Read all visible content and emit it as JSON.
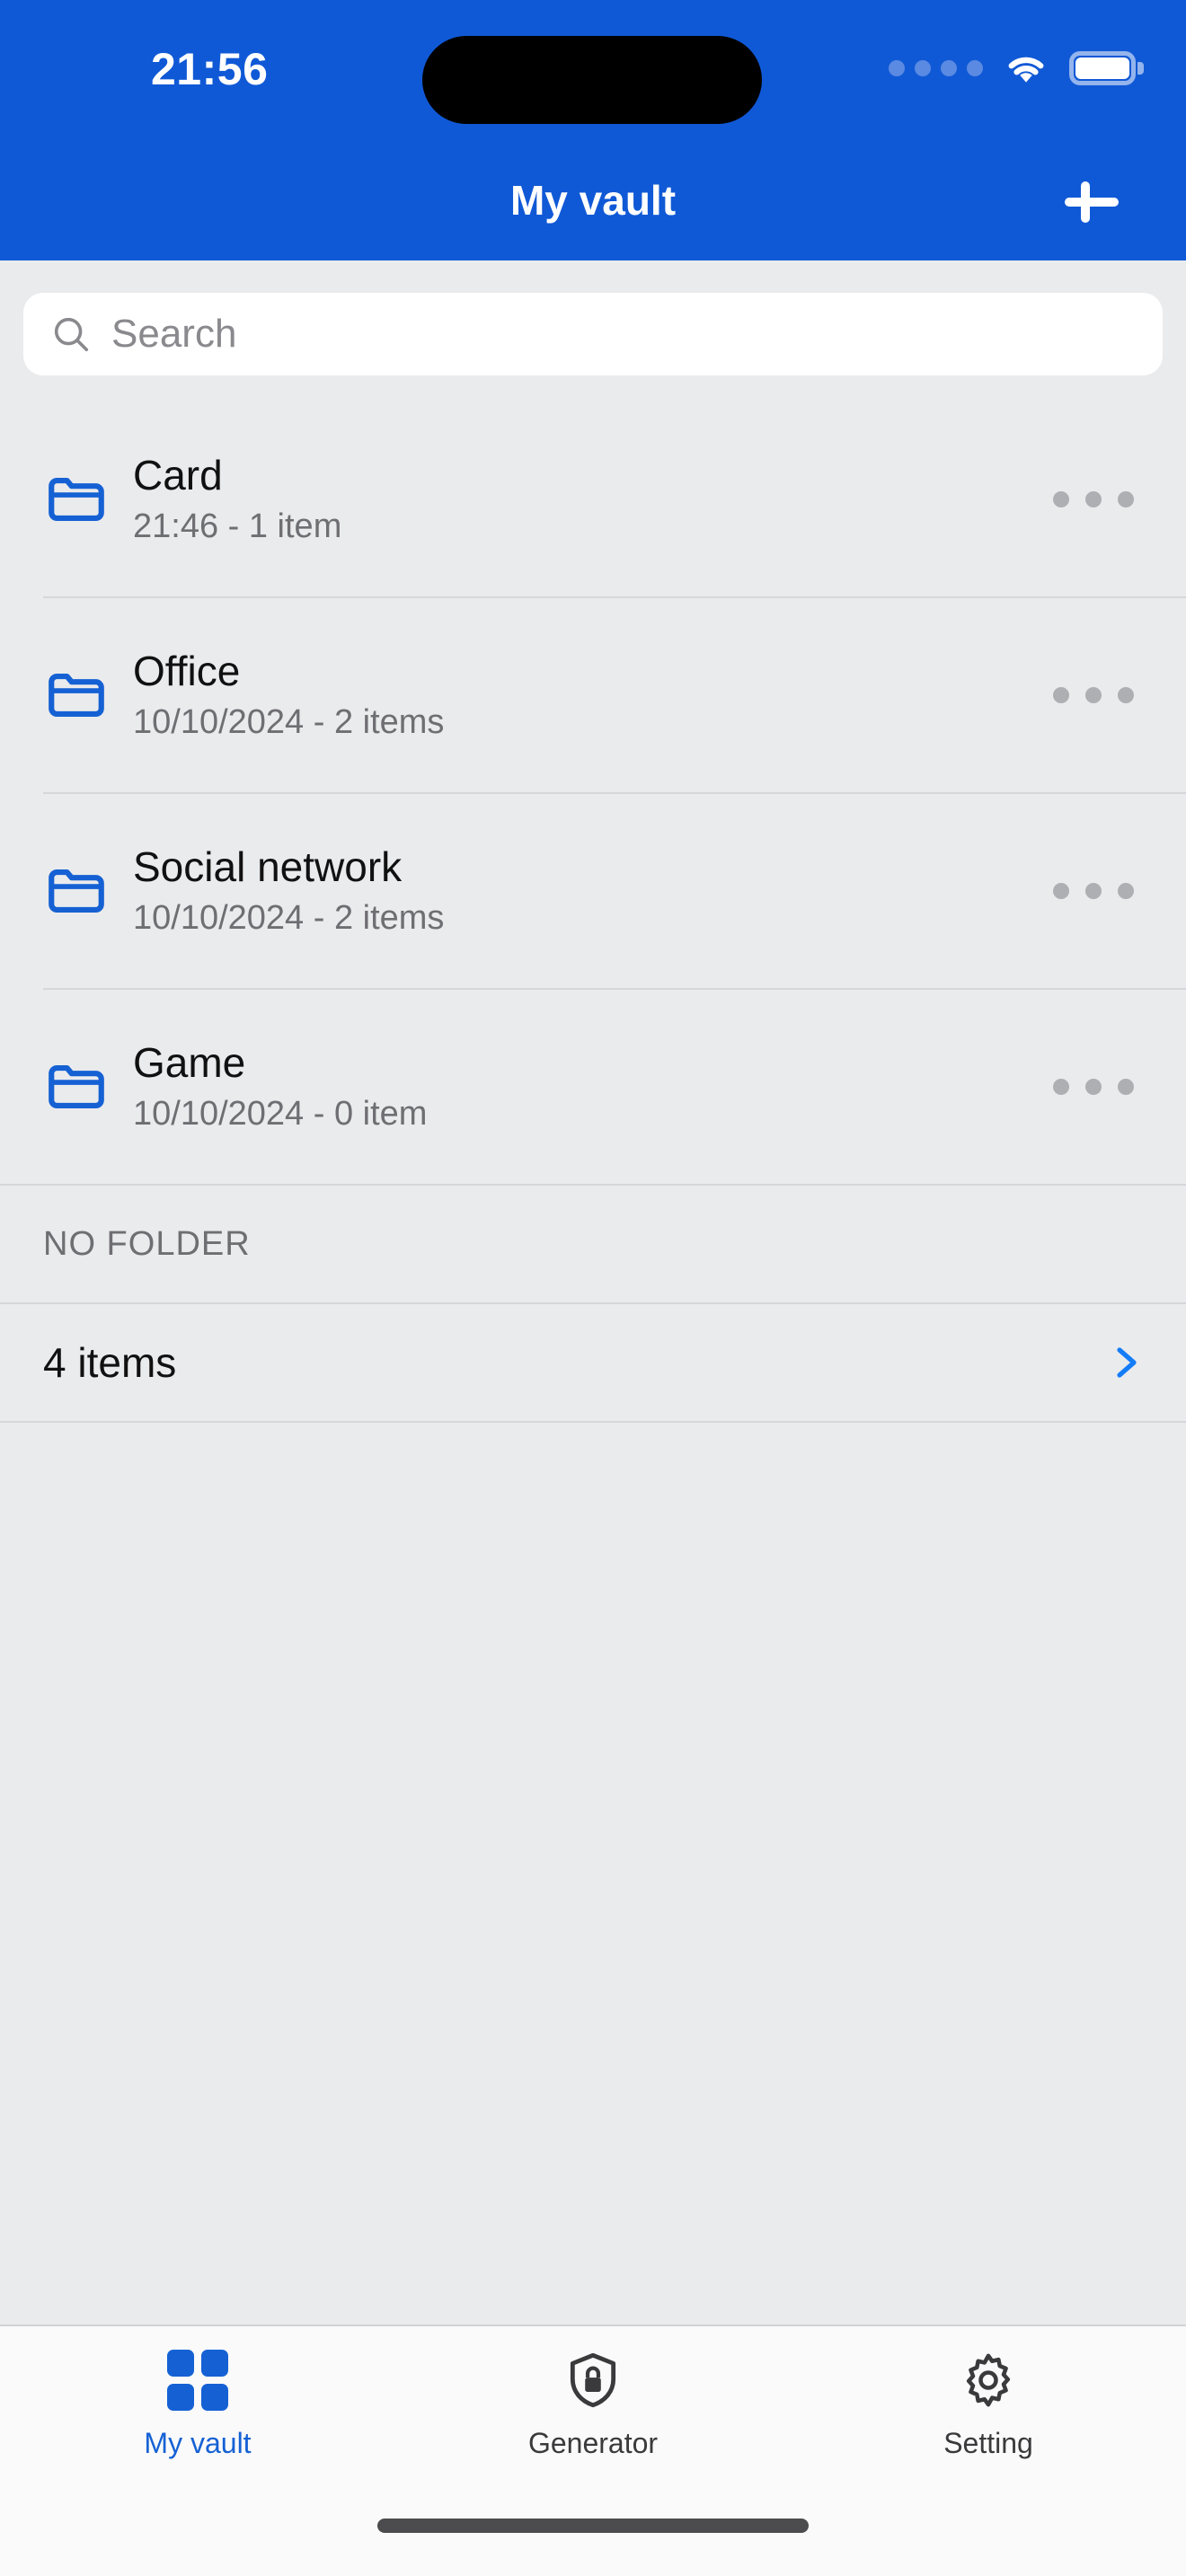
{
  "status_bar": {
    "time": "21:56",
    "cellular_icon": "cellular-dots-icon",
    "wifi_icon": "wifi-icon",
    "battery_icon": "battery-full-icon",
    "dynamic_island": "dynamic-island"
  },
  "header": {
    "title": "My vault",
    "add_icon": "plus-icon",
    "background_color": "#1059D6"
  },
  "search": {
    "placeholder": "Search",
    "value": "",
    "icon": "search-icon"
  },
  "folders": [
    {
      "name": "Card",
      "meta": "21:46 - 1 item",
      "icon": "folder-icon",
      "more_icon": "more-horizontal-icon"
    },
    {
      "name": "Office",
      "meta": "10/10/2024 - 2 items",
      "icon": "folder-icon",
      "more_icon": "more-horizontal-icon"
    },
    {
      "name": "Social network",
      "meta": "10/10/2024 - 2 items",
      "icon": "folder-icon",
      "more_icon": "more-horizontal-icon"
    },
    {
      "name": "Game",
      "meta": "10/10/2024 - 0 item",
      "icon": "folder-icon",
      "more_icon": "more-horizontal-icon"
    }
  ],
  "no_folder_section": {
    "header": "NO FOLDER",
    "row_label": "4 items",
    "chevron_icon": "chevron-right-icon"
  },
  "tabbar": {
    "items": [
      {
        "label": "My vault",
        "icon": "grid-icon",
        "active": true
      },
      {
        "label": "Generator",
        "icon": "shield-lock-icon",
        "active": false
      },
      {
        "label": "Setting",
        "icon": "gear-icon",
        "active": false
      }
    ]
  },
  "colors": {
    "brand_blue": "#1059D6",
    "accent_blue": "#1561D4",
    "chevron_blue": "#147CF7",
    "background_gray": "#EAEBED",
    "tabbar_background": "#FAFAFA",
    "muted_text": "#6E6E73"
  }
}
